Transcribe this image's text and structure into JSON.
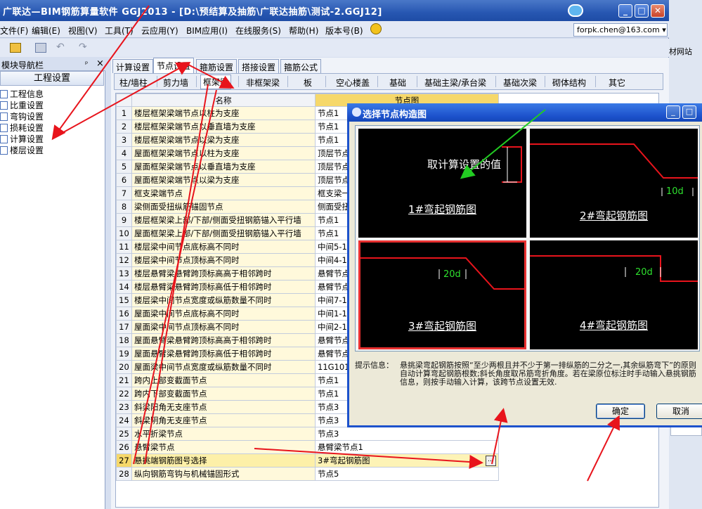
{
  "window": {
    "title": "广联达—BIM钢筋算量软件 GGJ2013 - [D:\\预结算及抽筋\\广联达抽筋\\测试-2.GGJ12]",
    "buttons": [
      "_",
      "□",
      "✕"
    ]
  },
  "menu": {
    "items": [
      "文件(F)",
      "编辑(E)",
      "视图(V)",
      "工具(T)",
      "云应用(Y)",
      "BIM应用(I)",
      "在线服务(S)",
      "帮助(H)",
      "版本号(B)"
    ],
    "account": "forpk.chen@163.com ▾"
  },
  "left_panel": {
    "header": "模块导航栏",
    "pin": "ᵖ",
    "close": "×",
    "section": "工程设置",
    "items": [
      "工程信息",
      "比重设置",
      "弯钩设置",
      "损耗设置",
      "计算设置",
      "楼层设置"
    ]
  },
  "tabs": [
    "计算设置",
    "节点设置",
    "箍筋设置",
    "搭接设置",
    "箍筋公式"
  ],
  "subtabs": [
    "柱/墙柱",
    "剪力墙",
    "框架梁",
    "非框架梁",
    "板",
    "空心楼盖",
    "基础",
    "基础主梁/承台梁",
    "基础次梁",
    "砌体结构",
    "其它"
  ],
  "grid": {
    "headers": [
      "",
      "名称",
      "节点图"
    ],
    "rows": [
      {
        "n": "1",
        "name": "楼层框架梁端节点以柱为支座",
        "val": "节点1"
      },
      {
        "n": "2",
        "name": "楼层框架梁端节点以垂直墙为支座",
        "val": "节点1"
      },
      {
        "n": "3",
        "name": "楼层框架梁端节点以梁为支座",
        "val": "节点1"
      },
      {
        "n": "4",
        "name": "屋面框架梁端节点以柱为支座",
        "val": "顶层节点"
      },
      {
        "n": "5",
        "name": "屋面框架梁端节点以垂直墙为支座",
        "val": "顶层节点"
      },
      {
        "n": "6",
        "name": "屋面框架梁端节点以梁为支座",
        "val": "顶层节点"
      },
      {
        "n": "7",
        "name": "框支梁端节点",
        "val": "框支梁一"
      },
      {
        "n": "8",
        "name": "梁侧面受扭纵筋锚固节点",
        "val": "侧面受扭"
      },
      {
        "n": "9",
        "name": "楼层框架梁上部/下部/侧面受扭钢筋锚入平行墙",
        "val": "节点1"
      },
      {
        "n": "10",
        "name": "屋面框架梁上部/下部/侧面受扭钢筋锚入平行墙",
        "val": "节点1"
      },
      {
        "n": "11",
        "name": "楼层梁中间节点底标高不同时",
        "val": "中间5-1"
      },
      {
        "n": "12",
        "name": "楼层梁中间节点顶标高不同时",
        "val": "中间4-1"
      },
      {
        "n": "13",
        "name": "楼层悬臂梁悬臂跨顶标高高于相邻跨时",
        "val": "悬臂节点"
      },
      {
        "n": "14",
        "name": "楼层悬臂梁悬臂跨顶标高低于相邻跨时",
        "val": "悬臂节点"
      },
      {
        "n": "15",
        "name": "楼层梁中间节点宽度或纵筋数量不同时",
        "val": "中间7-1"
      },
      {
        "n": "16",
        "name": "屋面梁中间节点底标高不同时",
        "val": "中间1-1"
      },
      {
        "n": "17",
        "name": "屋面梁中间节点顶标高不同时",
        "val": "中间2-1"
      },
      {
        "n": "18",
        "name": "屋面悬臂梁悬臂跨顶标高高于相邻跨时",
        "val": "悬臂节点"
      },
      {
        "n": "19",
        "name": "屋面悬臂梁悬臂跨顶标高低于相邻跨时",
        "val": "悬臂节点"
      },
      {
        "n": "20",
        "name": "屋面梁中间节点宽度或纵筋数量不同时",
        "val": "11G101节"
      },
      {
        "n": "21",
        "name": "跨内上部变截面节点",
        "val": "节点1"
      },
      {
        "n": "22",
        "name": "跨内下部变截面节点",
        "val": "节点1"
      },
      {
        "n": "23",
        "name": "斜梁阳角无支座节点",
        "val": "节点3"
      },
      {
        "n": "24",
        "name": "斜梁阴角无支座节点",
        "val": "节点3"
      },
      {
        "n": "25",
        "name": "水平折梁节点",
        "val": "节点3"
      },
      {
        "n": "26",
        "name": "悬臂梁节点",
        "val": "悬臂梁节点1"
      },
      {
        "n": "27",
        "name": "悬挑端钢筋图号选择",
        "val": "3#弯起钢筋图"
      },
      {
        "n": "28",
        "name": "纵向钢筋弯钩与机械锚固形式",
        "val": "节点5"
      }
    ],
    "selected_row": 27
  },
  "dialog": {
    "title": "选择节点构造图",
    "options": [
      {
        "caption": "1#弯起钢筋图",
        "note": "取计算设置的值"
      },
      {
        "caption": "2#弯起钢筋图",
        "dim": "10d"
      },
      {
        "caption": "3#弯起钢筋图",
        "dim": "20d"
      },
      {
        "caption": "4#弯起钢筋图",
        "dim": "20d"
      }
    ],
    "selected_option": 3,
    "hint_label": "提示信息：",
    "hint_text": "悬挑梁弯起钢筋按照“至少两根且并不少于第一排纵筋的二分之一,其余纵筋弯下”的原则自动计算弯起钢筋根数;斜长角度取吊筋弯折角度。若在梁原位标注时手动输入悬挑钢筋信息，则按手动输入计算，该跨节点设置无效.",
    "ok": "确定",
    "cancel": "取消"
  },
  "right_strip": {
    "text": "材网站"
  },
  "colors": {
    "annotation_red": "#e8141c",
    "annotation_green": "#22cc22",
    "selection": "#f6d86a"
  }
}
